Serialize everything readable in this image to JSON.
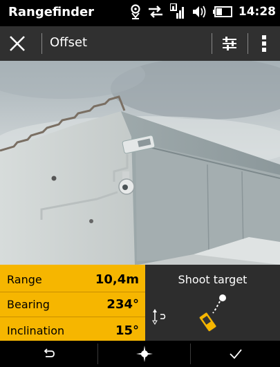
{
  "status_bar": {
    "app_name": "Rangefinder",
    "time": "14:28",
    "icons": [
      "location-icon",
      "data-transfer-icon",
      "signal-icon",
      "volume-icon",
      "battery-icon"
    ]
  },
  "toolbar": {
    "title": "Offset",
    "close_icon": "close-icon",
    "settings_icon": "sliders-icon",
    "menu_icon": "more-vert-icon"
  },
  "measurements": [
    {
      "label": "Range",
      "value": "10,4m"
    },
    {
      "label": "Bearing",
      "value": "234°"
    },
    {
      "label": "Inclination",
      "value": "15°"
    }
  ],
  "shoot": {
    "label": "Shoot target"
  },
  "nav": {
    "back_icon": "back-icon",
    "target_icon": "crosshair-icon",
    "confirm_icon": "check-icon"
  },
  "colors": {
    "accent": "#f6b600",
    "toolbar": "#303030",
    "panel_dark": "#2d2d2d"
  }
}
